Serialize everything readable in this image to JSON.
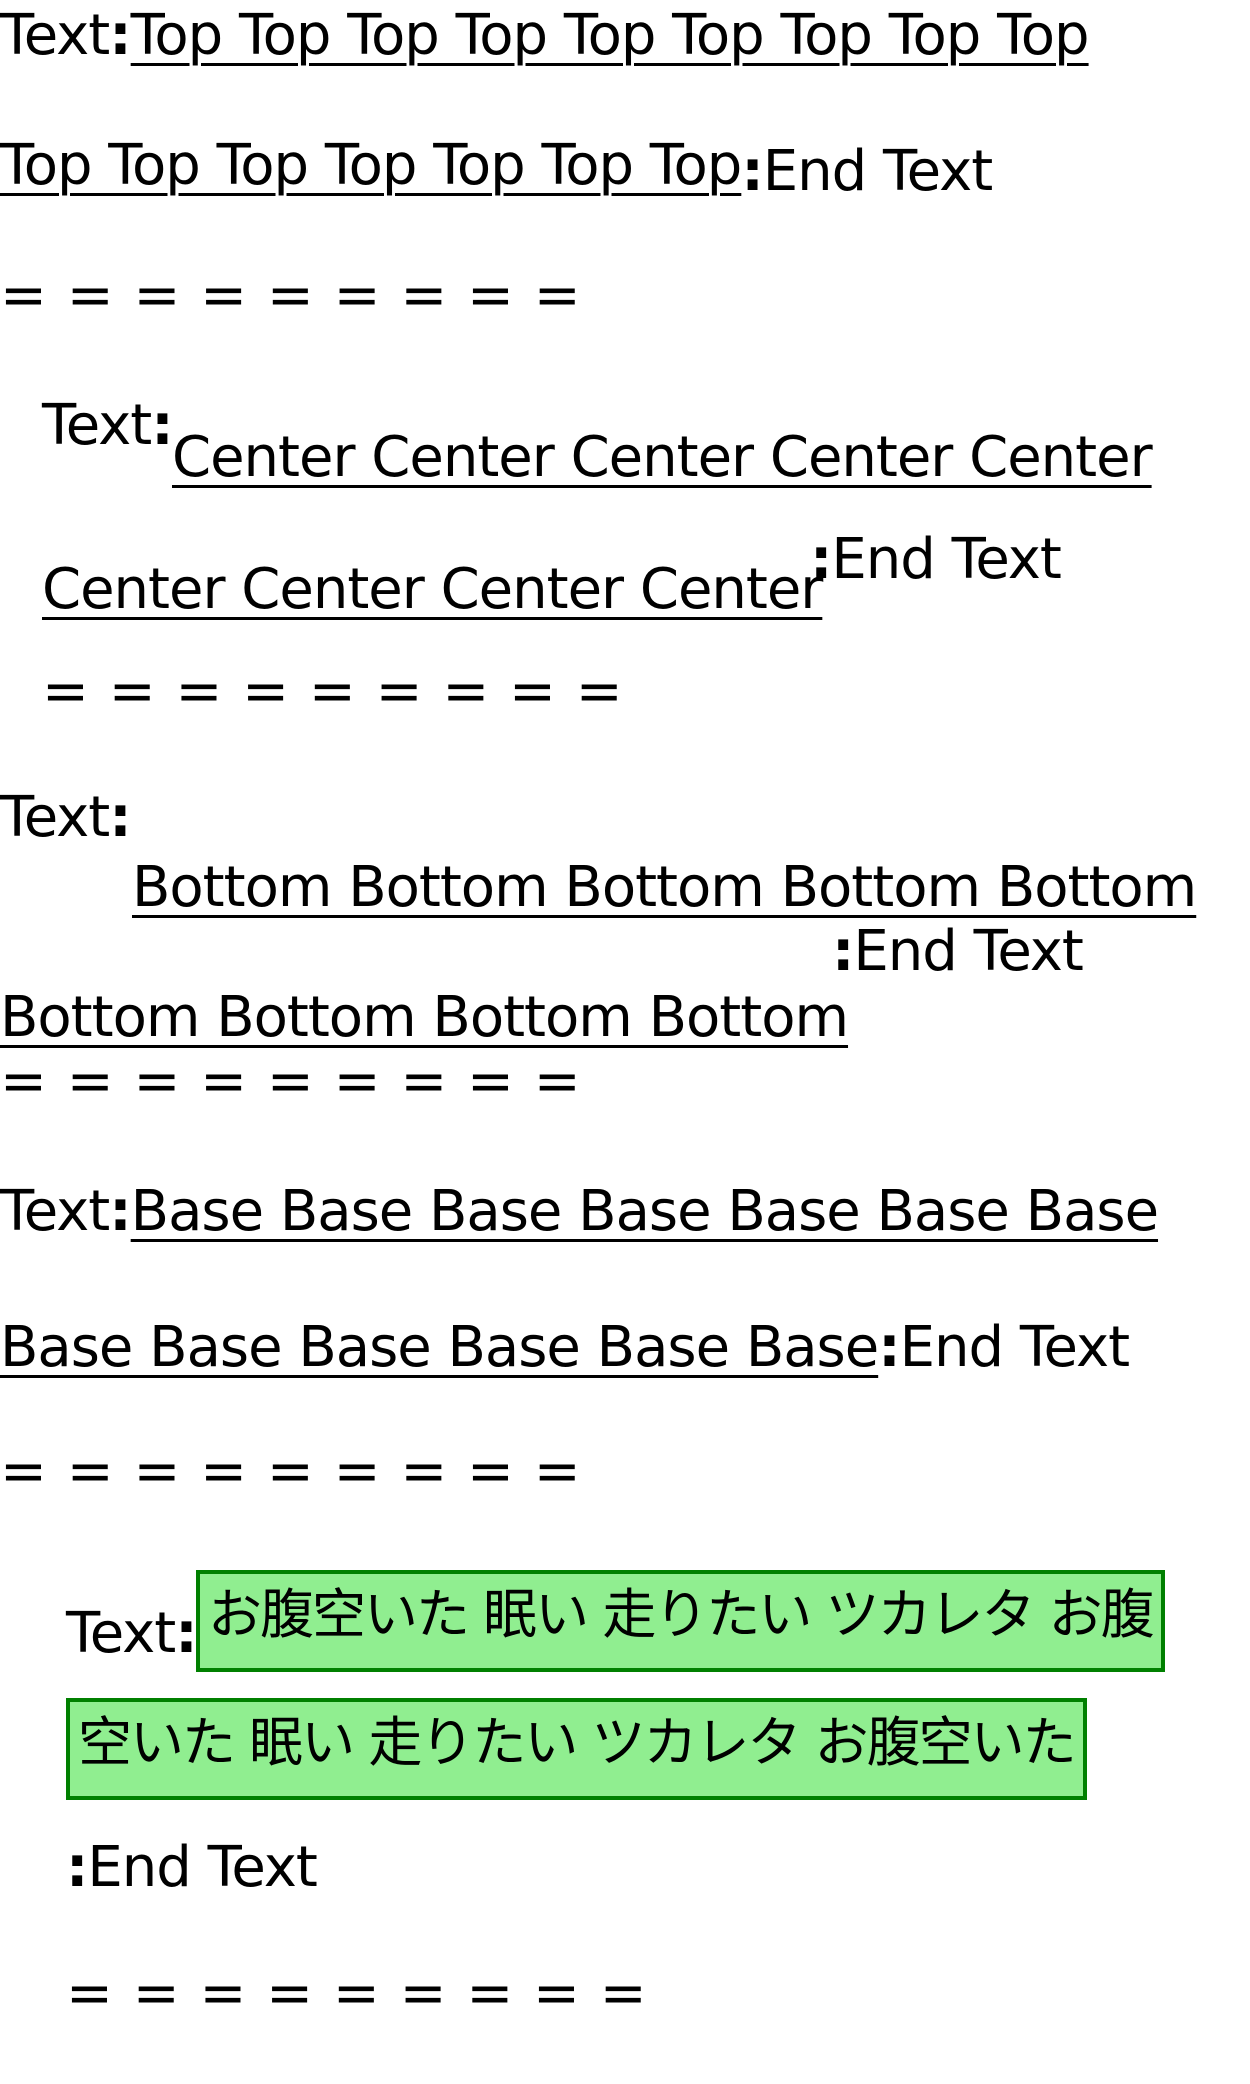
{
  "block_top": {
    "prefix": "Text",
    "colon": ":",
    "line1": "Top Top Top Top Top Top Top Top Top ",
    "line2": "Top Top Top Top Top Top Top",
    "suffix": "End Text"
  },
  "block_center": {
    "prefix": "Text",
    "colon": ":",
    "line1": "Center Center Center Center Center ",
    "line2": "Center Center Center Center",
    "suffix": "End Text"
  },
  "block_bottom": {
    "prefix": "Text",
    "colon": ":",
    "line1": "Bottom Bottom Bottom Bottom Bottom ",
    "line2": "Bottom Bottom Bottom Bottom",
    "suffix": "End Text"
  },
  "block_base": {
    "prefix": "Text",
    "colon": ":",
    "line1": "Base Base Base Base Base Base Base ",
    "line2": "Base Base Base Base Base Base",
    "suffix": "End Text"
  },
  "block_jp": {
    "prefix": "Text",
    "colon": ":",
    "line1": "お腹空いた 眠い 走りたい ツカレタ お腹",
    "line2": "空いた 眠い 走りたい ツカレタ お腹空いた",
    "suffix": "End Text",
    "highlight_bg": "#90ee90",
    "highlight_border": "#008000"
  },
  "separator": "= = = = = = = = ="
}
